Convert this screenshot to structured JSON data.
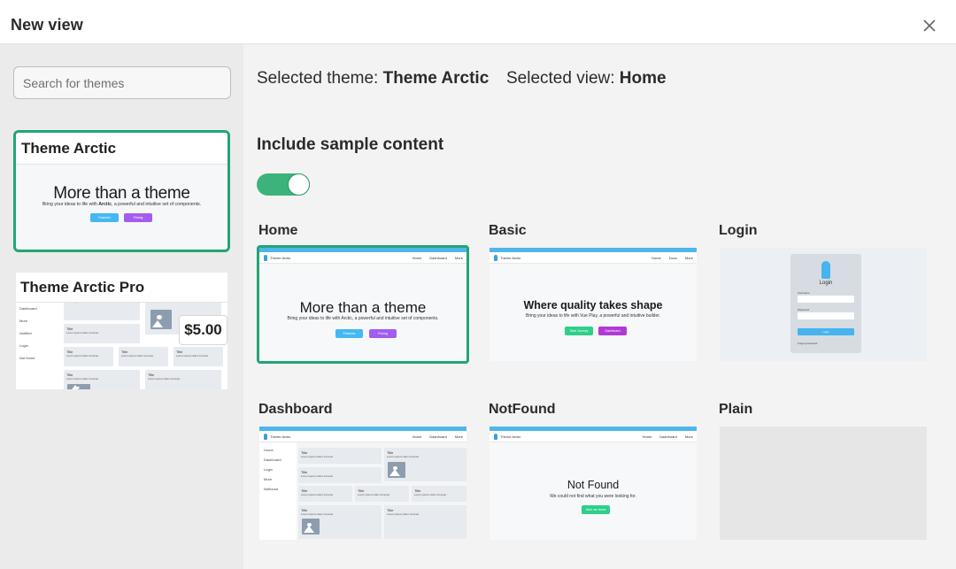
{
  "dialog": {
    "title": "New view"
  },
  "search": {
    "placeholder": "Search for themes"
  },
  "themes": [
    {
      "name": "Theme Arctic",
      "preview": {
        "headline": "More than a theme",
        "sub_prefix": "Bring your ideas to life with ",
        "sub_brand": "Arctic",
        "sub_suffix": ", a powerful and intuitive set of components.",
        "btn1": "Features",
        "btn2": "Pricing"
      }
    },
    {
      "name": "Theme Arctic Pro",
      "price": "$5.00",
      "preview": {
        "menu": [
          "Dashboard",
          "More",
          "Notified",
          "Login",
          "Not found"
        ],
        "tile_title": "Title",
        "tile_sub": "Lorem ipsum dolor sit amet"
      }
    }
  ],
  "selection": {
    "theme_prefix": "Selected theme:",
    "theme_value": "Theme Arctic",
    "view_prefix": "Selected view:",
    "view_value": "Home"
  },
  "sample_content": {
    "label": "Include sample content",
    "enabled": true
  },
  "views": [
    {
      "label": "Home",
      "brand": "Theme Arctic",
      "nav": [
        "Home",
        "Dashboard",
        "More"
      ],
      "headline": "More than a theme",
      "sub": "Bring your ideas to life with Arctic, a powerful and intuitive set of components.",
      "btn1": "Features",
      "btn2": "Pricing"
    },
    {
      "label": "Basic",
      "brand": "Theme Arctic",
      "nav": [
        "Home",
        "Docs",
        "More"
      ],
      "headline": "Where quality takes shape",
      "sub": "Bring your ideas to life with Vue Play, a powerful and intuitive builder.",
      "btn1": "Start Journey",
      "btn2": "Dashboard"
    },
    {
      "label": "Login",
      "form_title": "Login",
      "field1": "Username",
      "field2": "Password",
      "btn": "Login",
      "forgot": "Forgot password"
    },
    {
      "label": "Dashboard",
      "brand": "Theme Arctic",
      "nav": [
        "Home",
        "Dashboard",
        "More"
      ],
      "menu": [
        "Home",
        "Dashboard",
        "Login",
        "More",
        "Notfound"
      ],
      "tile_title": "Title",
      "tile_sub": "Lorem ipsum dolor sit amet"
    },
    {
      "label": "NotFound",
      "brand": "Theme Arctic",
      "nav": [
        "Home",
        "Dashboard",
        "More"
      ],
      "headline": "Not Found",
      "sub": "We could not find what you were looking for.",
      "btn": "Take me home"
    },
    {
      "label": "Plain"
    }
  ],
  "colors": {
    "accent": "#21a575",
    "toggle_on": "#3bb37a",
    "preview_topbar": "#4fb6ec",
    "preview_btn_blue": "#44b8f2",
    "preview_btn_purple": "#a45cf0",
    "preview_btn_green": "#2dcf8a",
    "preview_btn_magenta": "#b03ad6"
  }
}
